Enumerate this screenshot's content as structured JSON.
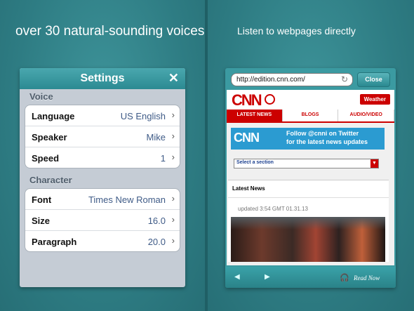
{
  "left": {
    "headline": "over 30 natural-sounding voices",
    "settings": {
      "title": "Settings",
      "close_icon": "close-icon",
      "voice_section": "Voice",
      "voice_rows": [
        {
          "key": "Language",
          "value": "US English"
        },
        {
          "key": "Speaker",
          "value": "Mike"
        },
        {
          "key": "Speed",
          "value": "1"
        }
      ],
      "character_section": "Character",
      "character_rows": [
        {
          "key": "Font",
          "value": "Times New Roman"
        },
        {
          "key": "Size",
          "value": "16.0"
        },
        {
          "key": "Paragraph",
          "value": "20.0"
        }
      ],
      "chevron": "›"
    }
  },
  "right": {
    "headline": "Listen to webpages directly",
    "browser": {
      "url": "http://edition.cnn.com/",
      "close_label": "Close",
      "cnn": {
        "logo": "CNN",
        "weather": "Weather",
        "tabs": [
          "LATEST NEWS",
          "BLOGS",
          "AUDIO/VIDEO"
        ],
        "banner_logo": "CNN",
        "banner_text_1": "Follow @cnni on Twitter",
        "banner_text_2": "for the latest news updates",
        "select_text": "Select a section",
        "latest_news": "Latest News",
        "updated": "updated 3:54 GMT 01.31.13"
      },
      "read_now": "Read Now"
    }
  },
  "colors": {
    "background": "#2f7f86",
    "nav_teal": "#2c8a92",
    "cnn_red": "#cc0000"
  }
}
